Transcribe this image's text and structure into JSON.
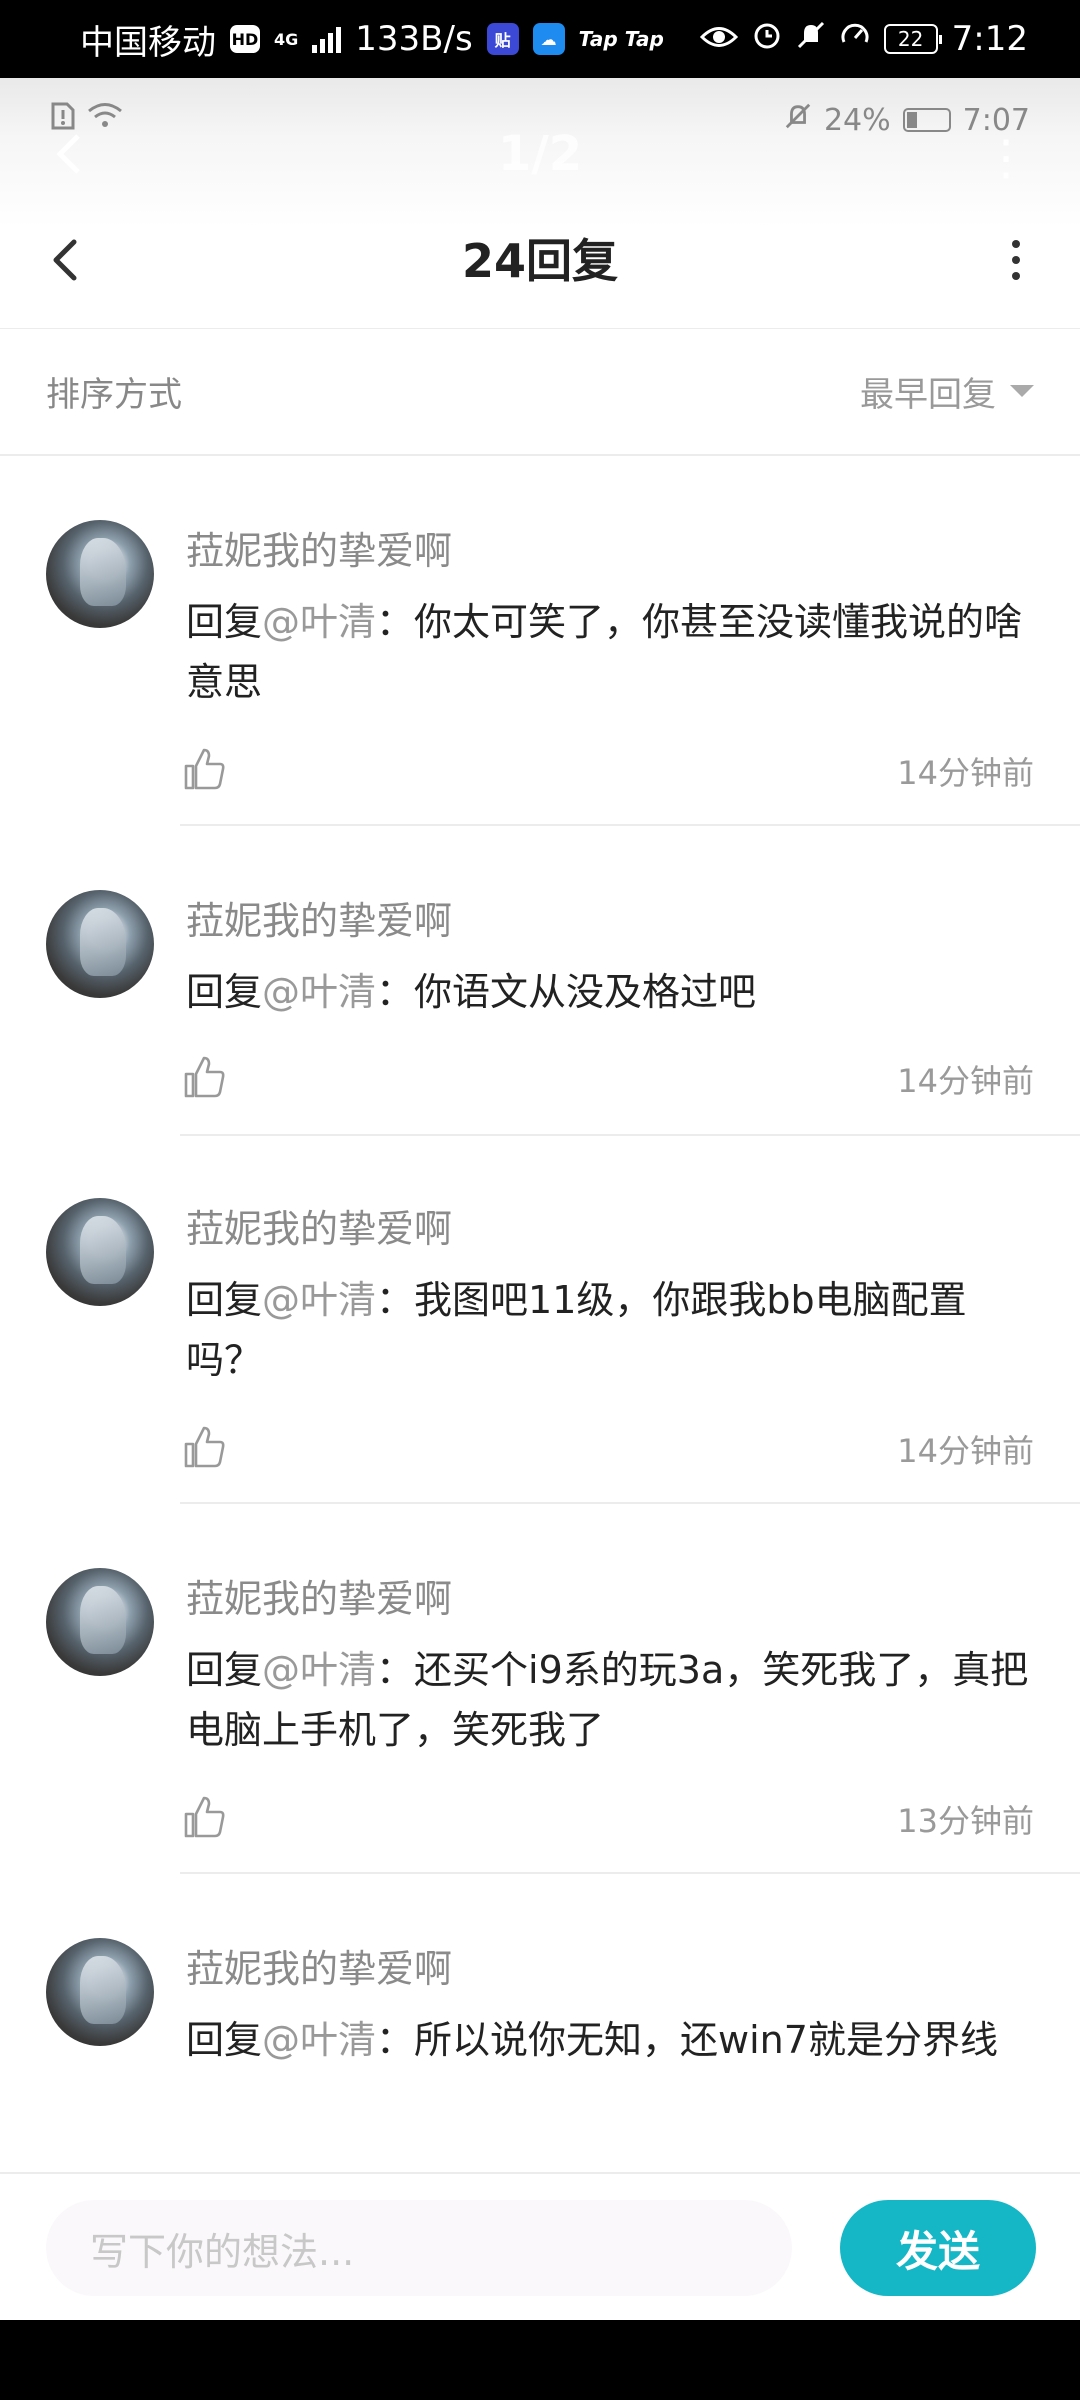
{
  "system_status": {
    "carrier": "中国移动",
    "hd": "HD",
    "network": "4G",
    "speed": "133B/s",
    "tie_icon_label": "贴",
    "tap1": "Tap",
    "tap2": "Tap",
    "battery": "22",
    "time": "7:12"
  },
  "inner_status": {
    "battery_pct": "24%",
    "time": "7:07"
  },
  "ghost_header": {
    "page": "1/2"
  },
  "header": {
    "title": "24回复"
  },
  "sort": {
    "label": "排序方式",
    "selected": "最早回复"
  },
  "replies": [
    {
      "author": "菈妮我的挚爱啊",
      "prefix": "回复",
      "mention": "@叶清",
      "colon": "：",
      "text": "你太可笑了，你甚至没读懂我说的啥意思",
      "time": "14分钟前"
    },
    {
      "author": "菈妮我的挚爱啊",
      "prefix": "回复",
      "mention": "@叶清",
      "colon": "：",
      "text": "你语文从没及格过吧",
      "time": "14分钟前"
    },
    {
      "author": "菈妮我的挚爱啊",
      "prefix": "回复",
      "mention": "@叶清",
      "colon": "：",
      "text": "我图吧11级，你跟我bb电脑配置吗？",
      "time": "14分钟前"
    },
    {
      "author": "菈妮我的挚爱啊",
      "prefix": "回复",
      "mention": "@叶清",
      "colon": "：",
      "text": "还买个i9系的玩3a，笑死我了，真把电脑上手机了，笑死我了",
      "time": "13分钟前"
    },
    {
      "author": "菈妮我的挚爱啊",
      "prefix": "回复",
      "mention": "@叶清",
      "colon": "：",
      "text": "所以说你无知，还win7就是分界线",
      "time": ""
    }
  ],
  "composer": {
    "placeholder": "写下你的想法...",
    "send_label": "发送"
  },
  "colors": {
    "accent": "#15b7c7",
    "muted_text": "#8a8a8a"
  },
  "icons": [
    "back-arrow-icon",
    "more-vertical-icon",
    "caret-down-icon",
    "thumbs-up-icon",
    "wifi-icon",
    "alarm-icon",
    "mute-icon",
    "eye-icon"
  ]
}
